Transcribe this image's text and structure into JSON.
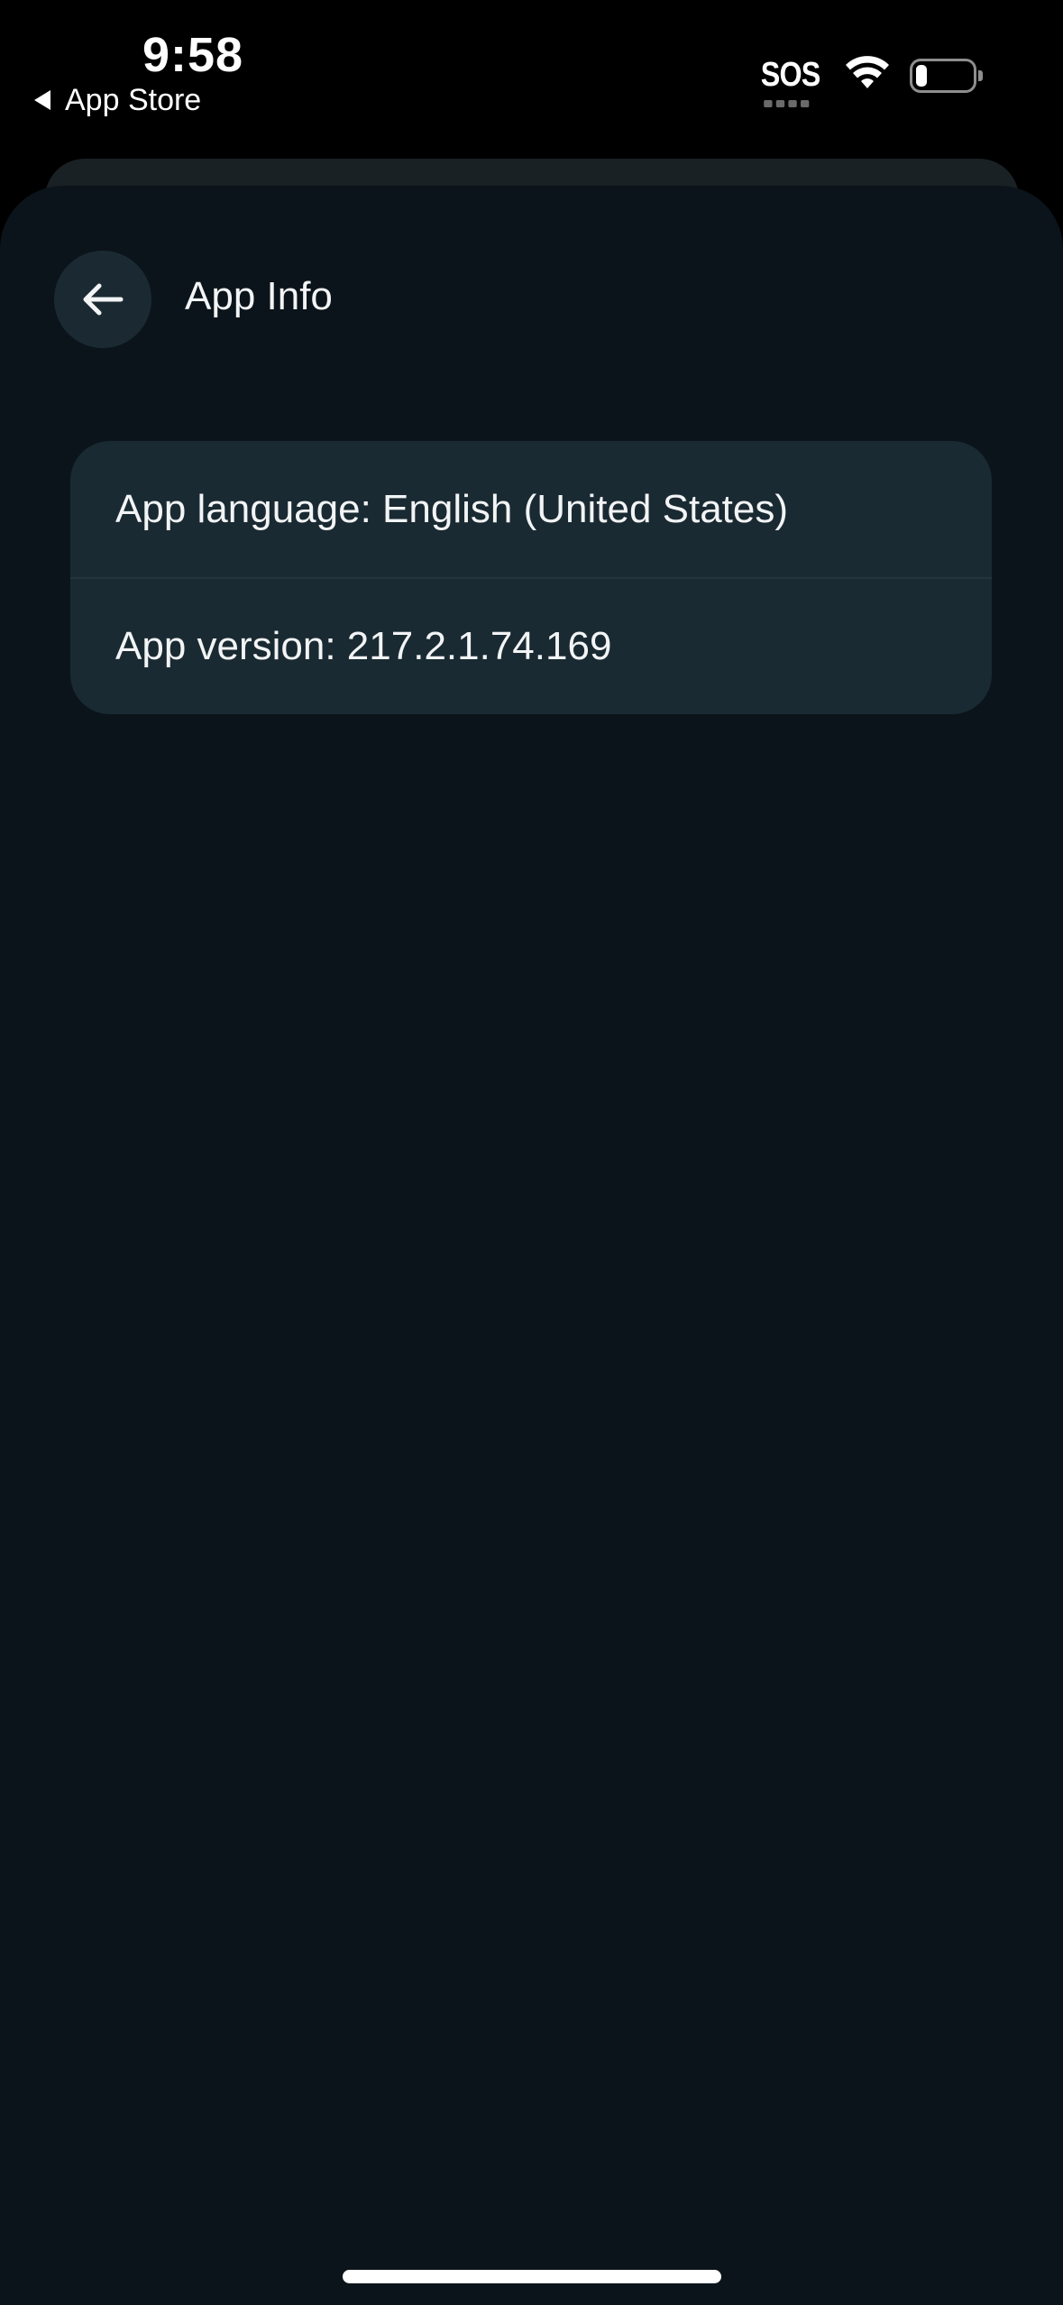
{
  "status_bar": {
    "time": "9:58",
    "back_app": "App Store",
    "sos": "SOS",
    "wifi_icon": "wifi-icon",
    "battery_icon": "battery-low-icon",
    "battery_level": 0.2
  },
  "header": {
    "back_icon": "arrow-left-icon",
    "title": "App Info"
  },
  "info": {
    "rows": [
      {
        "text": "App language: English (United States)"
      },
      {
        "text": "App version: 217.2.1.74.169"
      }
    ]
  },
  "colors": {
    "background": "#0b141a",
    "card": "#1a2a32",
    "back_button": "#1b2a32",
    "text": "#f2f4f5"
  }
}
